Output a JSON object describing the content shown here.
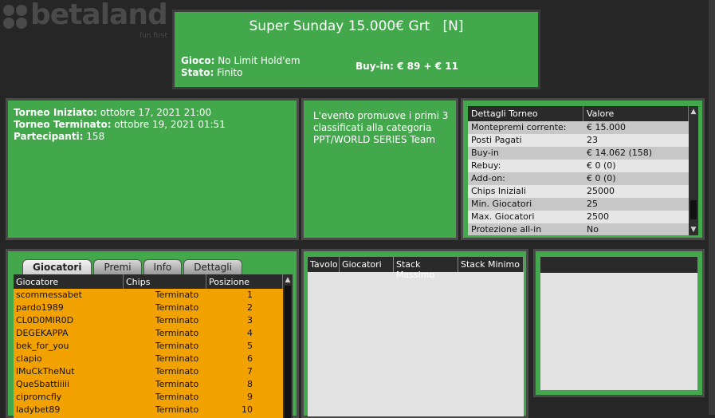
{
  "brand": {
    "name": "betaland",
    "tagline": "fun first"
  },
  "header": {
    "title": "Super Sunday 15.000€ Grt   [N]",
    "game_label": "Gioco:",
    "game_value": "No Limit Hold'em",
    "status_label": "Stato:",
    "status_value": "Finito",
    "buyin": "Buy-in: € 89 + € 11"
  },
  "info": {
    "start_label": "Torneo Iniziato:",
    "start_value": "ottobre 17, 2021 21:00",
    "end_label": "Torneo Terminato:",
    "end_value": "ottobre 19, 2021 01:51",
    "participants_label": "Partecipanti:",
    "participants_value": "158"
  },
  "description": "L'evento promuove i primi 3 classificati alla categoria PPT/WORLD SERIES Team",
  "details": {
    "col1": "Dettagli Torneo",
    "col2": "Valore",
    "rows": [
      {
        "k": "Montepremi corrente:",
        "v": "€ 15.000"
      },
      {
        "k": "Posti Pagati",
        "v": "23"
      },
      {
        "k": "Buy-in",
        "v": "€ 14.062 (158)"
      },
      {
        "k": "Rebuy:",
        "v": "€ 0 (0)"
      },
      {
        "k": "Add-on:",
        "v": "€ 0 (0)"
      },
      {
        "k": "Chips Iniziali",
        "v": "25000"
      },
      {
        "k": "Min. Giocatori",
        "v": "25"
      },
      {
        "k": "Max. Giocatori",
        "v": "2500"
      },
      {
        "k": "Protezione all-in",
        "v": "No"
      }
    ]
  },
  "tabs": [
    "Giocatori",
    "Premi",
    "Info",
    "Dettagli"
  ],
  "players": {
    "cols": [
      "Giocatore",
      "Chips",
      "Posizione"
    ],
    "rows": [
      {
        "name": "scommessabet",
        "chips": "Terminato",
        "pos": "1"
      },
      {
        "name": "pardo1989",
        "chips": "Terminato",
        "pos": "2"
      },
      {
        "name": "CL0D0MIR0D",
        "chips": "Terminato",
        "pos": "3"
      },
      {
        "name": "DEGEKAPPA",
        "chips": "Terminato",
        "pos": "4"
      },
      {
        "name": "bek_for_you",
        "chips": "Terminato",
        "pos": "5"
      },
      {
        "name": "clapio",
        "chips": "Terminato",
        "pos": "6"
      },
      {
        "name": "lMuCkTheNut",
        "chips": "Terminato",
        "pos": "7"
      },
      {
        "name": "QueSbattiiiii",
        "chips": "Terminato",
        "pos": "8"
      },
      {
        "name": "cipromcfly",
        "chips": "Terminato",
        "pos": "9"
      },
      {
        "name": "ladybet89",
        "chips": "Terminato",
        "pos": "10"
      }
    ]
  },
  "tables": {
    "cols": [
      "Tavolo",
      "Giocatori",
      "Stack Massimo",
      "Stack Minimo"
    ]
  },
  "colors": {
    "panel": "#43a84c",
    "players_bg": "#f2a200",
    "bg": "#262626"
  }
}
